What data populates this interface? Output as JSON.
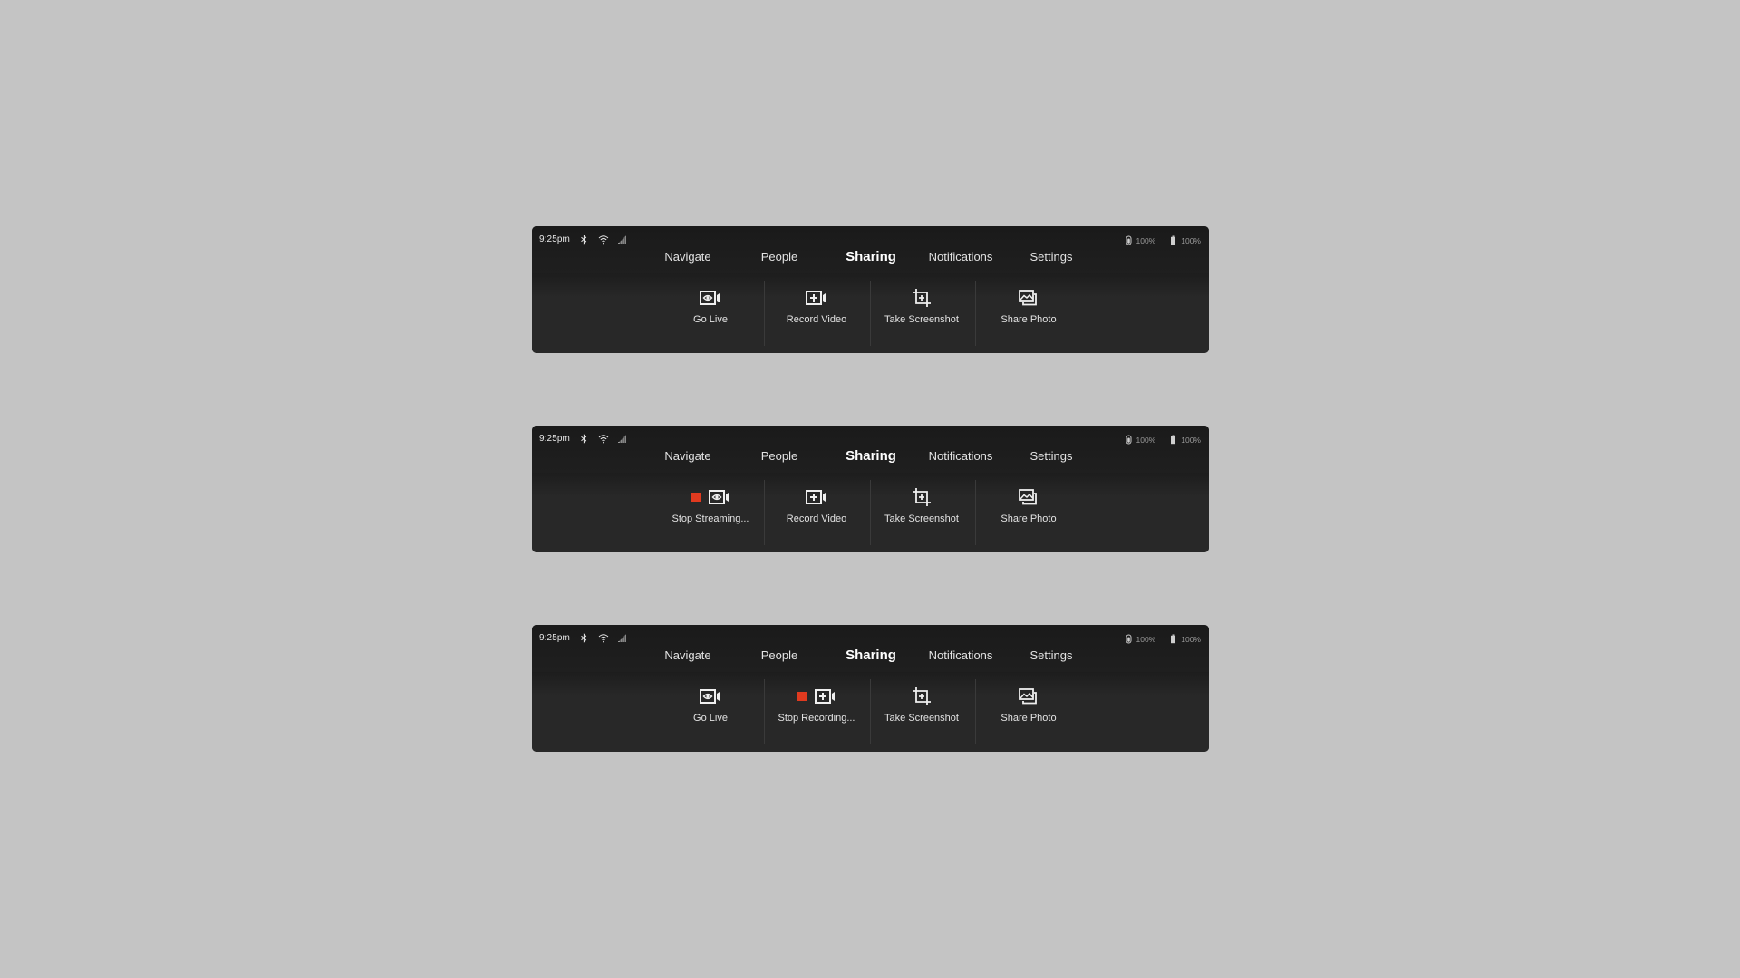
{
  "panels": [
    {
      "status": {
        "time": "9:25pm",
        "device1_battery": "100%",
        "device2_battery": "100%"
      },
      "tabs": [
        "Navigate",
        "People",
        "Sharing",
        "Notifications",
        "Settings"
      ],
      "active_tab": "Sharing",
      "actions": [
        {
          "label": "Go Live",
          "icon": "live-stream-icon",
          "active": false
        },
        {
          "label": "Record Video",
          "icon": "record-video-icon",
          "active": false
        },
        {
          "label": "Take Screenshot",
          "icon": "screenshot-icon",
          "active": false
        },
        {
          "label": "Share Photo",
          "icon": "share-photo-icon",
          "active": false
        }
      ]
    },
    {
      "status": {
        "time": "9:25pm",
        "device1_battery": "100%",
        "device2_battery": "100%"
      },
      "tabs": [
        "Navigate",
        "People",
        "Sharing",
        "Notifications",
        "Settings"
      ],
      "active_tab": "Sharing",
      "actions": [
        {
          "label": "Stop Streaming...",
          "icon": "live-stream-icon",
          "active": true
        },
        {
          "label": "Record Video",
          "icon": "record-video-icon",
          "active": false
        },
        {
          "label": "Take Screenshot",
          "icon": "screenshot-icon",
          "active": false
        },
        {
          "label": "Share Photo",
          "icon": "share-photo-icon",
          "active": false
        }
      ]
    },
    {
      "status": {
        "time": "9:25pm",
        "device1_battery": "100%",
        "device2_battery": "100%"
      },
      "tabs": [
        "Navigate",
        "People",
        "Sharing",
        "Notifications",
        "Settings"
      ],
      "active_tab": "Sharing",
      "actions": [
        {
          "label": "Go Live",
          "icon": "live-stream-icon",
          "active": false
        },
        {
          "label": "Stop Recording...",
          "icon": "record-video-icon",
          "active": true
        },
        {
          "label": "Take Screenshot",
          "icon": "screenshot-icon",
          "active": false
        },
        {
          "label": "Share Photo",
          "icon": "share-photo-icon",
          "active": false
        }
      ]
    }
  ],
  "colors": {
    "background": "#c4c4c4",
    "panel": "#262626",
    "stop_indicator": "#e03a1f",
    "text": "#e3e3e3"
  }
}
